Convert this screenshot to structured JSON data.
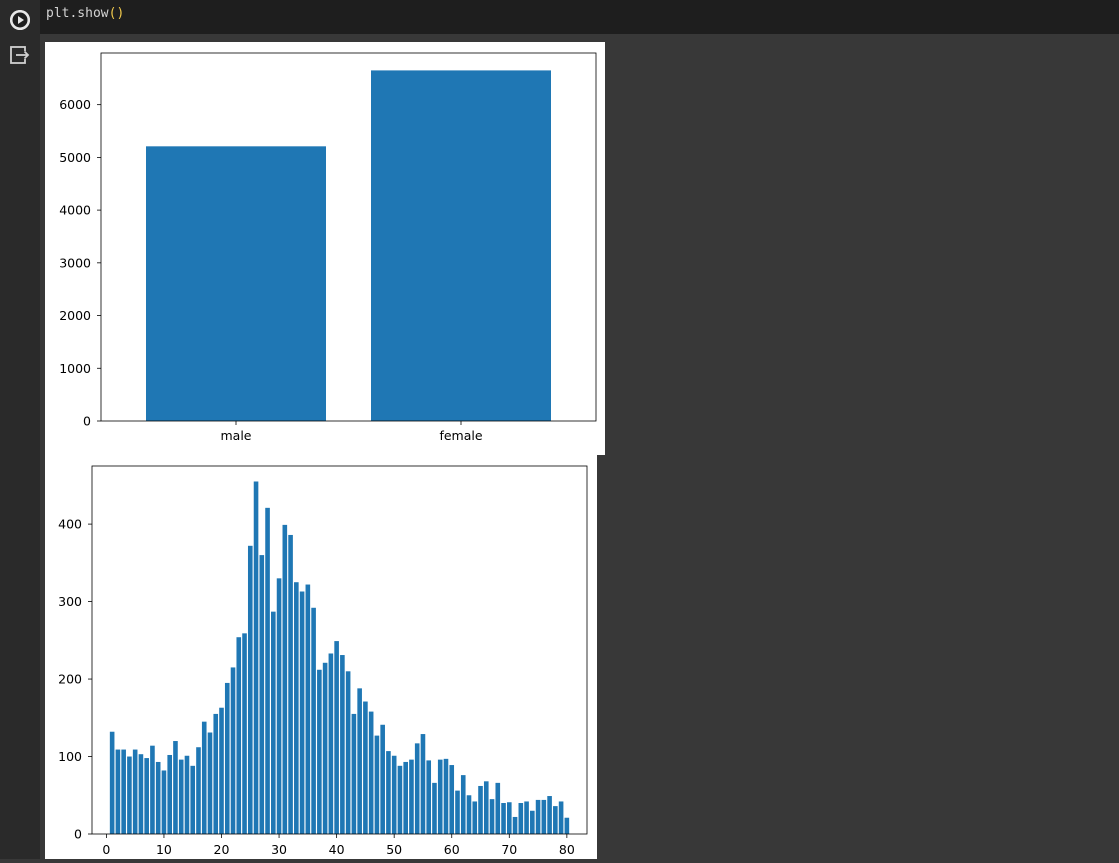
{
  "cell": {
    "code_line": "plt.show",
    "code_parens": "()",
    "run_icon": "play-icon",
    "output_icon": "output-exit-icon"
  },
  "colors": {
    "bar": "#1f77b4",
    "background": "#383838",
    "gutter": "#2a2a2a",
    "code_bg": "#1e1e1e"
  },
  "chart_data": [
    {
      "type": "bar",
      "title": "",
      "xlabel": "",
      "ylabel": "",
      "categories": [
        "male",
        "female"
      ],
      "values": [
        5210,
        6650
      ],
      "ylim": [
        0,
        6980
      ],
      "yticks": [
        0,
        1000,
        2000,
        3000,
        4000,
        5000,
        6000
      ],
      "grid": false
    },
    {
      "type": "bar",
      "title": "",
      "xlabel": "",
      "ylabel": "",
      "x": [
        1,
        2,
        3,
        4,
        5,
        6,
        7,
        8,
        9,
        10,
        11,
        12,
        13,
        14,
        15,
        16,
        17,
        18,
        19,
        20,
        21,
        22,
        23,
        24,
        25,
        26,
        27,
        28,
        29,
        30,
        31,
        32,
        33,
        34,
        35,
        36,
        37,
        38,
        39,
        40,
        41,
        42,
        43,
        44,
        45,
        46,
        47,
        48,
        49,
        50,
        51,
        52,
        53,
        54,
        55,
        56,
        57,
        58,
        59,
        60,
        61,
        62,
        63,
        64,
        65,
        66,
        67,
        68,
        69,
        70,
        71,
        72,
        73,
        74,
        75,
        76,
        77,
        78,
        79,
        80
      ],
      "values": [
        132,
        109,
        109,
        100,
        109,
        103,
        98,
        114,
        93,
        82,
        102,
        120,
        96,
        101,
        88,
        112,
        145,
        131,
        155,
        163,
        195,
        215,
        254,
        259,
        372,
        455,
        360,
        421,
        287,
        330,
        399,
        386,
        325,
        313,
        322,
        292,
        212,
        221,
        233,
        249,
        231,
        210,
        155,
        188,
        171,
        158,
        127,
        141,
        107,
        101,
        88,
        93,
        96,
        117,
        129,
        95,
        66,
        96,
        97,
        89,
        56,
        76,
        50,
        42,
        62,
        68,
        45,
        66,
        40,
        41,
        22,
        40,
        42,
        30,
        44,
        44,
        49,
        36,
        42,
        21
      ],
      "xlim": [
        -2.5,
        83.5
      ],
      "ylim": [
        0,
        475
      ],
      "xticks": [
        0,
        10,
        20,
        30,
        40,
        50,
        60,
        70,
        80
      ],
      "yticks": [
        0,
        100,
        200,
        300,
        400
      ],
      "grid": false
    }
  ]
}
